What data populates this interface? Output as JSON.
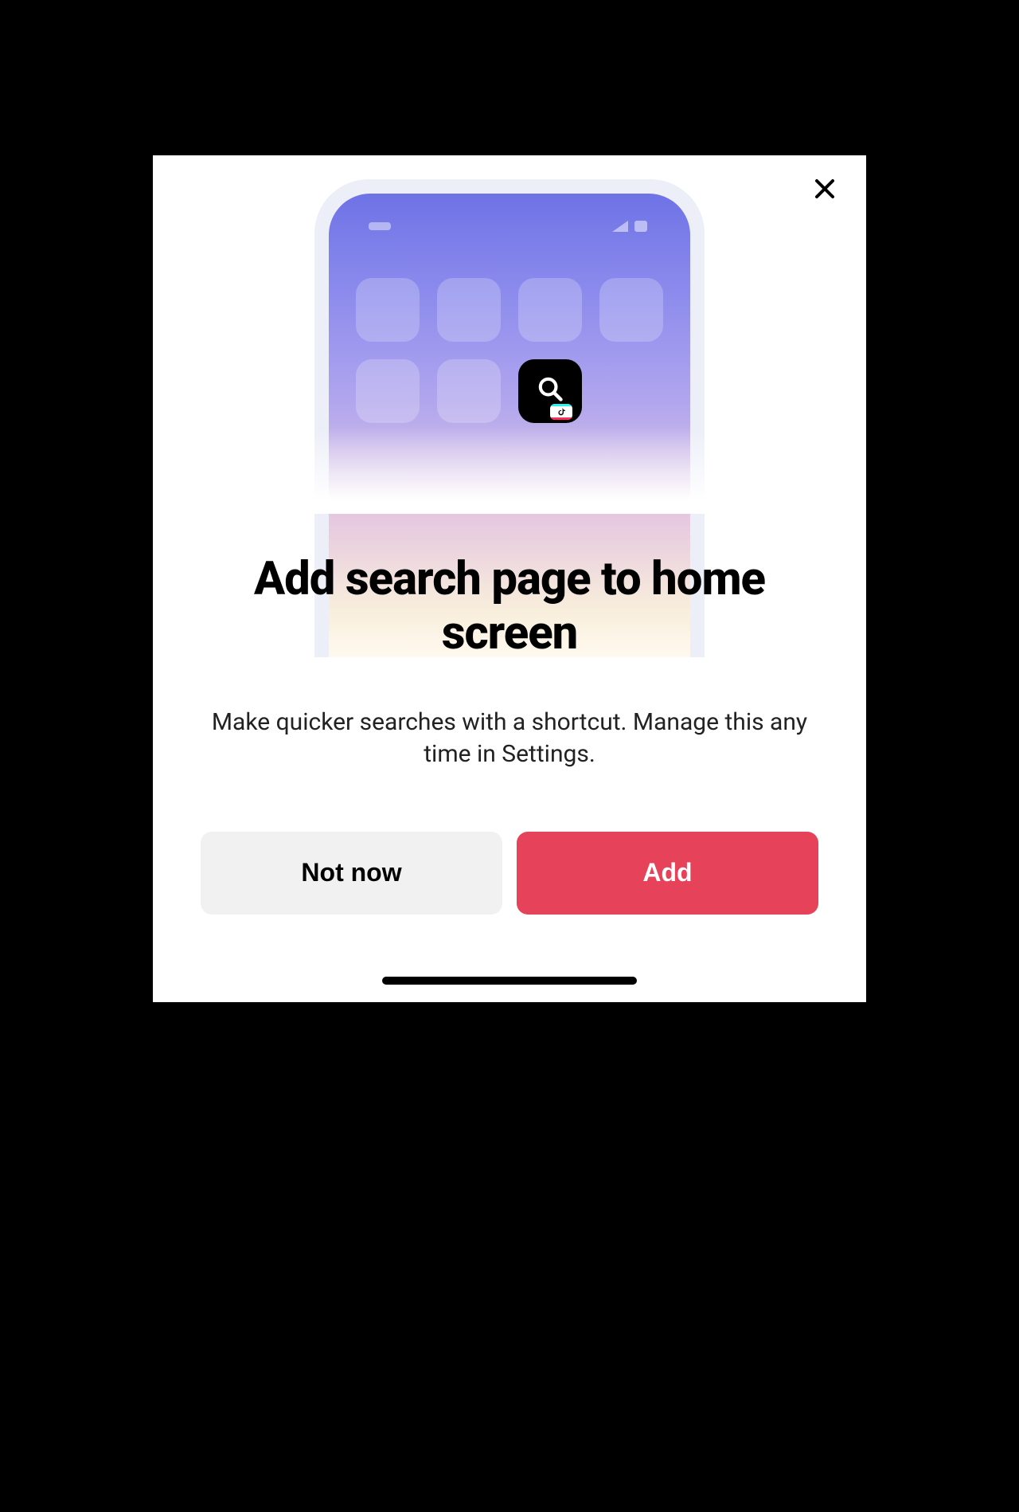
{
  "modal": {
    "title": "Add search page to home screen",
    "subtitle": "Make quicker searches with a shortcut. Manage this any time in Settings.",
    "not_now_label": "Not now",
    "add_label": "Add"
  },
  "colors": {
    "primary_button": "#e6425a",
    "secondary_button": "#f1f1f2"
  }
}
